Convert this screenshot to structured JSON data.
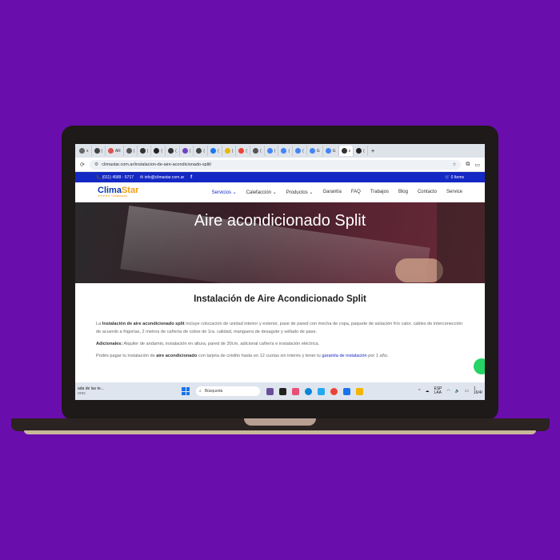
{
  "browser": {
    "tabs": [
      {
        "label": "x",
        "color": "#666666"
      },
      {
        "label": "|",
        "color": "#444444"
      },
      {
        "label": "AR",
        "color": "#d9534f"
      },
      {
        "label": "|",
        "color": "#555555"
      },
      {
        "label": "|",
        "color": "#333333"
      },
      {
        "label": "(",
        "color": "#222222"
      },
      {
        "label": "(",
        "color": "#333333"
      },
      {
        "label": "(",
        "color": "#6f42c1"
      },
      {
        "label": "(",
        "color": "#444444"
      },
      {
        "label": "(",
        "color": "#1877f2"
      },
      {
        "label": "(",
        "color": "#e6b800"
      },
      {
        "label": "(",
        "color": "#ea4335"
      },
      {
        "label": "(",
        "color": "#555555"
      },
      {
        "label": "(",
        "color": "#4285f4"
      },
      {
        "label": "(",
        "color": "#4285f4"
      },
      {
        "label": "(",
        "color": "#4285f4"
      },
      {
        "label": "G",
        "color": "#4285f4"
      },
      {
        "label": "G",
        "color": "#4285f4"
      },
      {
        "label": "x",
        "color": "#333333"
      },
      {
        "label": "(",
        "color": "#222222"
      }
    ],
    "new_tab": "+",
    "url": "climastar.com.ar/instalacion-de-aire-acondicionado-split/"
  },
  "site": {
    "phone": "(011) 4589 - 5717",
    "email": "info@climastar.com.ar",
    "facebook": "f",
    "cart": "0 Items",
    "logo_main": "Clima",
    "logo_accent": "Star",
    "logo_sub": "★★★★★ Climatización",
    "menu": [
      {
        "label": "Servicios ⌄",
        "active": true
      },
      {
        "label": "Calefacción ⌄",
        "active": false
      },
      {
        "label": "Productos ⌄",
        "active": false
      },
      {
        "label": "Garantía",
        "active": false
      },
      {
        "label": "FAQ",
        "active": false
      },
      {
        "label": "Trabajos",
        "active": false
      },
      {
        "label": "Blog",
        "active": false
      },
      {
        "label": "Contacto",
        "active": false
      },
      {
        "label": "Service",
        "active": false
      }
    ],
    "hero_title": "Aire acondicionado Split",
    "heading": "Instalación de Aire Acondicionado Split",
    "p1_pre": "La ",
    "p1_bold": "Instalación de aire acondicionado split",
    "p1_post": " incluye colocación de unidad interior y exterior, pase de pared con mecha de copa, paquete de aislación frío calor, cables de interconección de acuerdo a frigorías, 2 metros de cañería de cobre de 1ra. calidad, manguera de desagote y sellado de pase.",
    "p2_bold": "Adicionales:",
    "p2_post": " Alquiler de andamio, instalación en altura, pared de 30cm, adicional cañería e instalación eléctrica.",
    "p3_pre": "Podés pagar tu instalación de ",
    "p3_bold": "aire acondicionado",
    "p3_mid": " con tarjeta de crédito hasta en 12 cuotas sin interés y tener tu ",
    "p3_link": "garantía de instalación",
    "p3_post": " por 1 año."
  },
  "taskbar": {
    "left_line1": "ada de las te...",
    "left_line2": "ores",
    "search_placeholder": "Búsqueda",
    "lang_line1": "ESP",
    "lang_line2": "LAA",
    "clock_line1": "1",
    "clock_line2": "16/4/"
  },
  "colors": {
    "background": "#6a0dad",
    "site_blue": "#1428c4",
    "whatsapp": "#25d366"
  }
}
